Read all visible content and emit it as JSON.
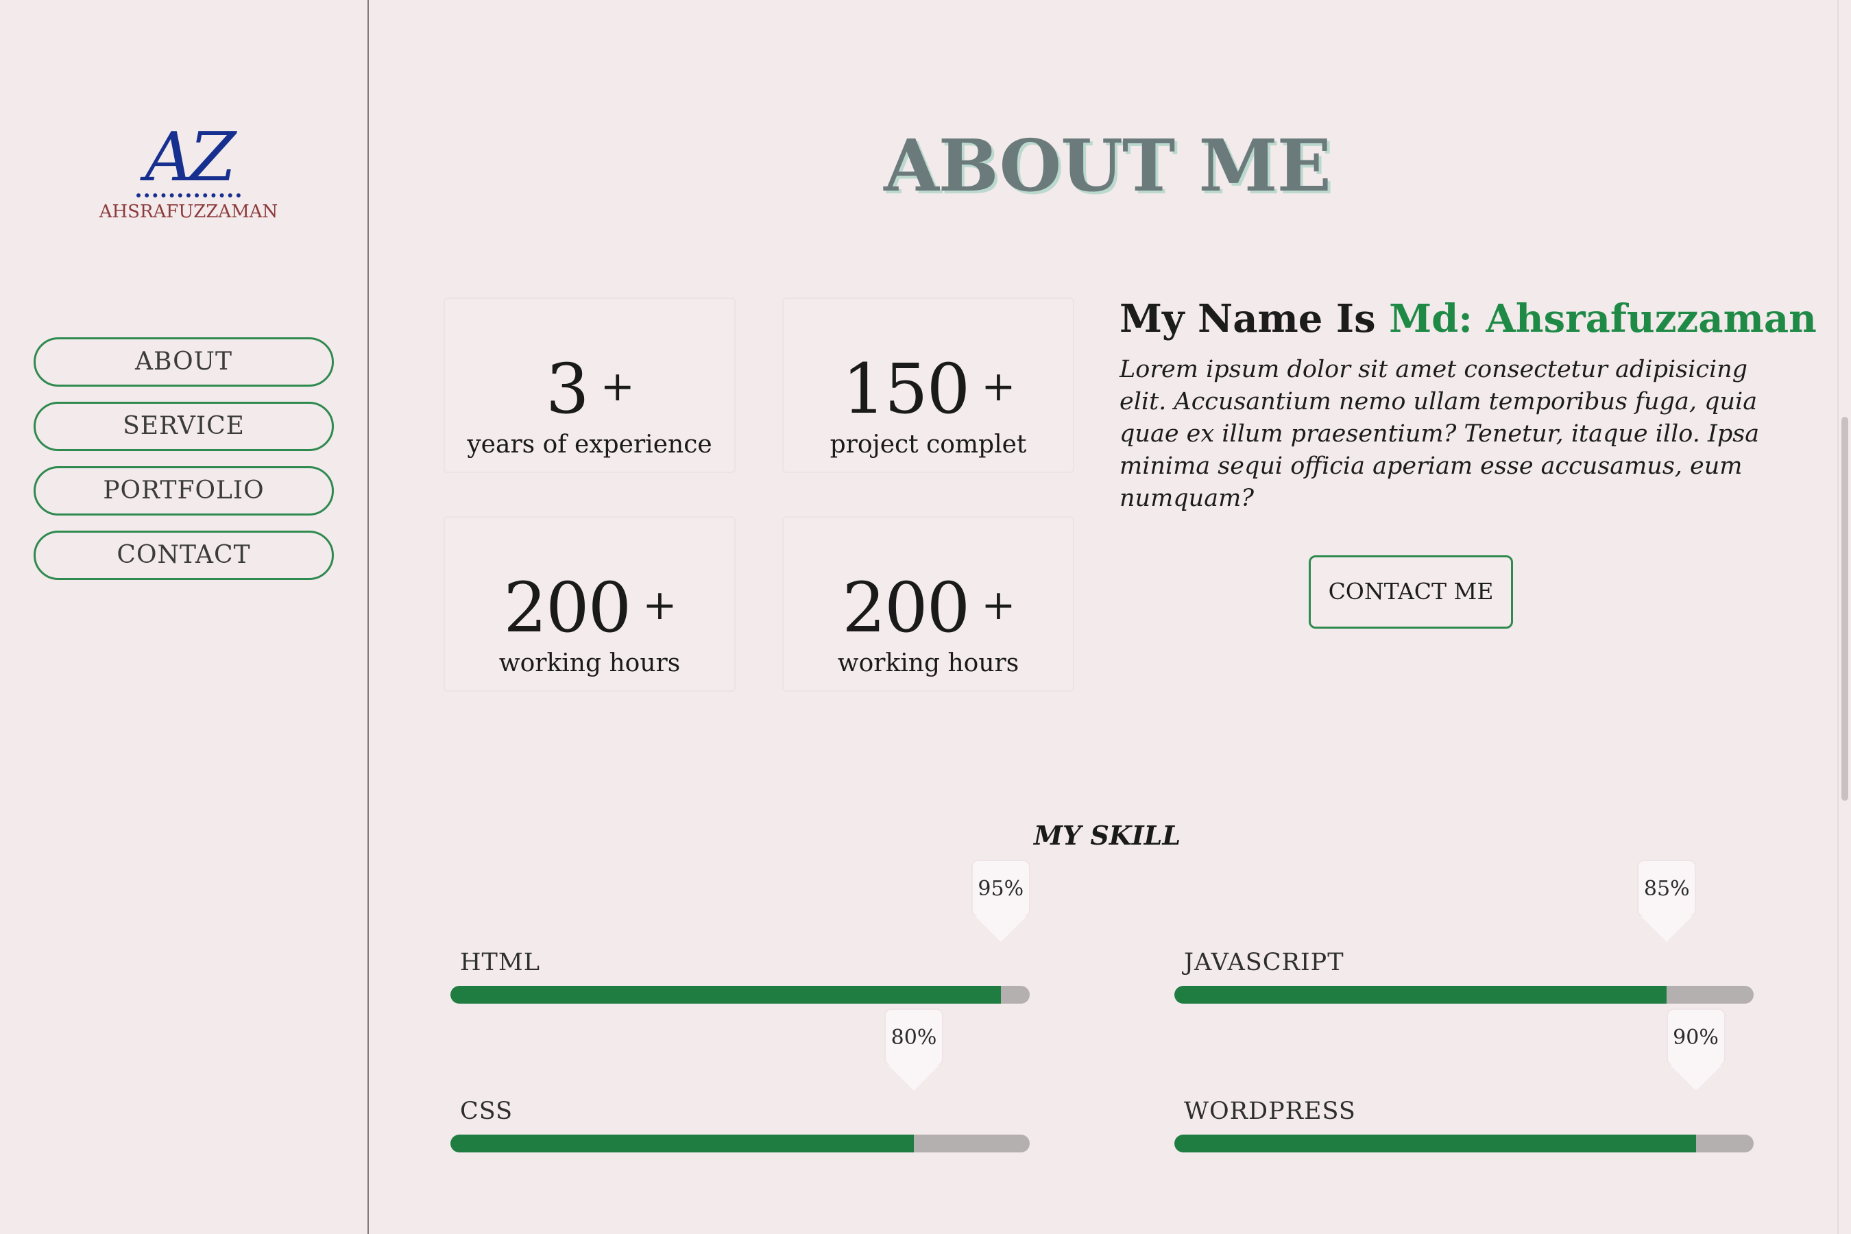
{
  "logo": {
    "mark": "AZ",
    "name": "AHSRAFUZZAMAN"
  },
  "nav": [
    "ABOUT",
    "SERVICE",
    "PORTFOLIO",
    "CONTACT"
  ],
  "title": "ABOUT ME",
  "stats": [
    {
      "value": "3",
      "suffix": "+",
      "label": "years of experience"
    },
    {
      "value": "150",
      "suffix": "+",
      "label": "project complet"
    },
    {
      "value": "200",
      "suffix": "+",
      "label": "working hours"
    },
    {
      "value": "200",
      "suffix": "+",
      "label": "working hours"
    }
  ],
  "intro": {
    "prefix": "My Name Is ",
    "name": "Md: Ahsrafuzzaman",
    "text": "Lorem ipsum dolor sit amet consectetur adipisicing elit. Accusantium nemo ullam temporibus fuga, quia quae ex illum praesentium? Tenetur, itaque illo. Ipsa minima sequi officia aperiam esse accusamus, eum numquam?",
    "button": "CONTACT ME"
  },
  "skills_title": "MY SKILL",
  "skills": [
    {
      "name": "HTML",
      "percent": 95,
      "percent_label": "95%"
    },
    {
      "name": "JAVASCRIPT",
      "percent": 85,
      "percent_label": "85%"
    },
    {
      "name": "CSS",
      "percent": 80,
      "percent_label": "80%"
    },
    {
      "name": "WORDPRESS",
      "percent": 90,
      "percent_label": "90%"
    }
  ],
  "colors": {
    "accent": "#1f7d42",
    "background": "#f3eaeb",
    "logo_blue": "#17308f",
    "logo_red": "#8c3a3a"
  }
}
